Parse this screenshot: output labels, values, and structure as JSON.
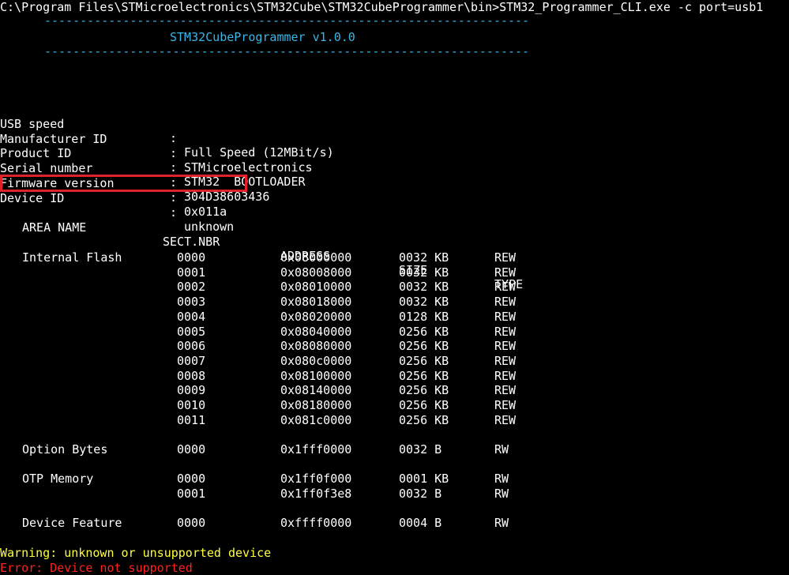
{
  "command_line": "C:\\Program Files\\STMicroelectronics\\STM32Cube\\STM32CubeProgrammer\\bin>STM32_Programmer_CLI.exe -c port=usb1",
  "banner": {
    "rule": "--------------------------------------------------------------------",
    "title": "STM32CubeProgrammer v1.0.0"
  },
  "device_info": [
    {
      "key": "USB speed",
      "value": "Full Speed (12MBit/s)"
    },
    {
      "key": "Manufacturer ID",
      "value": "STMicroelectronics"
    },
    {
      "key": "Product ID",
      "value": "STM32  BOOTLOADER"
    },
    {
      "key": "Serial number",
      "value": "304D38603436"
    },
    {
      "key": "Firmware version",
      "value": "0x011a"
    },
    {
      "key": "Device ID",
      "value": "unknown"
    }
  ],
  "separator": ":",
  "table": {
    "headers": [
      "AREA NAME",
      "SECT.NBR",
      "ADDRESS",
      "SIZE",
      "TYPE"
    ],
    "groups": [
      {
        "area": "Internal Flash",
        "rows": [
          [
            "0000",
            "0x08000000",
            "0032 KB",
            "REW"
          ],
          [
            "0001",
            "0x08008000",
            "0032 KB",
            "REW"
          ],
          [
            "0002",
            "0x08010000",
            "0032 KB",
            "REW"
          ],
          [
            "0003",
            "0x08018000",
            "0032 KB",
            "REW"
          ],
          [
            "0004",
            "0x08020000",
            "0128 KB",
            "REW"
          ],
          [
            "0005",
            "0x08040000",
            "0256 KB",
            "REW"
          ],
          [
            "0006",
            "0x08080000",
            "0256 KB",
            "REW"
          ],
          [
            "0007",
            "0x080c0000",
            "0256 KB",
            "REW"
          ],
          [
            "0008",
            "0x08100000",
            "0256 KB",
            "REW"
          ],
          [
            "0009",
            "0x08140000",
            "0256 KB",
            "REW"
          ],
          [
            "0010",
            "0x08180000",
            "0256 KB",
            "REW"
          ],
          [
            "0011",
            "0x081c0000",
            "0256 KB",
            "REW"
          ]
        ]
      },
      {
        "area": "Option Bytes",
        "rows": [
          [
            "0000",
            "0x1fff0000",
            "0032 B",
            "RW"
          ]
        ]
      },
      {
        "area": "OTP Memory",
        "rows": [
          [
            "0000",
            "0x1ff0f000",
            "0001 KB",
            "RW"
          ],
          [
            "0001",
            "0x1ff0f3e8",
            "0032 B",
            "RW"
          ]
        ]
      },
      {
        "area": "Device Feature",
        "rows": [
          [
            "0000",
            "0xffff0000",
            "0004 B",
            "RW"
          ]
        ]
      }
    ]
  },
  "warning": "Warning: unknown or unsupported device",
  "error": "Error: Device not supported",
  "colors": {
    "background": "#000000",
    "text": "#ffffff",
    "banner": "#3ab5e6",
    "warning": "#ffff3c",
    "error": "#ff2020",
    "highlight": "#e0202a"
  }
}
